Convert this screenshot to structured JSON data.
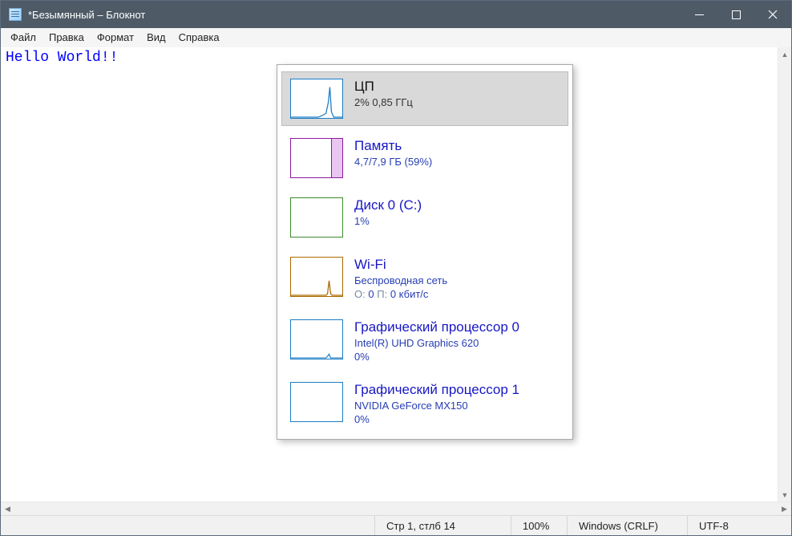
{
  "window": {
    "title": "*Безымянный – Блокнот"
  },
  "menu": {
    "items": [
      "Файл",
      "Правка",
      "Формат",
      "Вид",
      "Справка"
    ]
  },
  "editor": {
    "content": "Hello World!!"
  },
  "statusbar": {
    "position": "Стр 1, стлб 14",
    "zoom": "100%",
    "eol": "Windows (CRLF)",
    "encoding": "UTF-8"
  },
  "perf": {
    "items": [
      {
        "key": "cpu",
        "title": "ЦП",
        "sub1": "2%  0,85 ГГц",
        "selected": true,
        "thumb_class": "cpu-thumb",
        "thumb_kind": "cpu"
      },
      {
        "key": "memory",
        "title": "Память",
        "sub1": "4,7/7,9 ГБ (59%)",
        "thumb_class": "mem-thumb",
        "thumb_kind": "memory"
      },
      {
        "key": "disk0",
        "title": "Диск 0 (C:)",
        "sub1": "1%",
        "thumb_class": "disk-thumb",
        "thumb_kind": "flat"
      },
      {
        "key": "wifi",
        "title": "Wi-Fi",
        "sub1": "Беспроводная сеть",
        "sub2_prefix": "О:",
        "sub2_val1": "0",
        "sub2_mid": "П:",
        "sub2_val2": "0 кбит/с",
        "thumb_class": "wifi-thumb",
        "thumb_kind": "wifi"
      },
      {
        "key": "gpu0",
        "title": "Графический процессор 0",
        "sub1": "Intel(R) UHD Graphics 620",
        "sub2_plain": "0%",
        "thumb_class": "gpu-thumb",
        "thumb_kind": "gpu"
      },
      {
        "key": "gpu1",
        "title": "Графический процессор 1",
        "sub1": "NVIDIA GeForce MX150",
        "sub2_plain": "0%",
        "thumb_class": "gpu-thumb",
        "thumb_kind": "flat"
      }
    ]
  }
}
